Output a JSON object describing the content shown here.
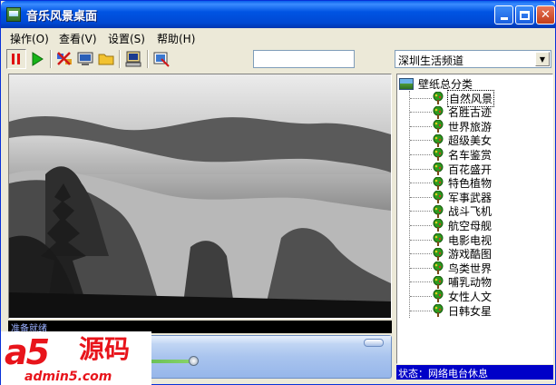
{
  "window": {
    "title": "音乐风景桌面"
  },
  "menu": {
    "items": [
      {
        "label": "操作(O)"
      },
      {
        "label": "查看(V)"
      },
      {
        "label": "设置(S)"
      },
      {
        "label": "帮助(H)"
      }
    ]
  },
  "toolbar": {
    "search_value": "",
    "channel_selected": "深圳生活频道",
    "icons": [
      "pause-icon",
      "play-icon",
      "shuffle-icon",
      "monitor-icon",
      "folder-icon",
      "desktop-icon",
      "wallpaper-icon"
    ]
  },
  "viewer": {
    "status_message": "准备就绪"
  },
  "player": {
    "volume_level_percent": 95
  },
  "tree": {
    "root_label": "壁纸总分类",
    "selected_index": 0,
    "items": [
      {
        "label": "自然风景"
      },
      {
        "label": "名胜古迹"
      },
      {
        "label": "世界旅游"
      },
      {
        "label": "超级美女"
      },
      {
        "label": "名车鉴赏"
      },
      {
        "label": "百花盛开"
      },
      {
        "label": "特色植物"
      },
      {
        "label": "军事武器"
      },
      {
        "label": "战斗飞机"
      },
      {
        "label": "航空母舰"
      },
      {
        "label": "电影电视"
      },
      {
        "label": "游戏酷图"
      },
      {
        "label": "鸟类世界"
      },
      {
        "label": "哺乳动物"
      },
      {
        "label": "女性人文"
      },
      {
        "label": "日韩女星"
      }
    ]
  },
  "statusbar": {
    "text": "状态：网络电台休息"
  },
  "watermark": {
    "brand": "a5",
    "brand_cn": "源码",
    "url": "admin5.com"
  },
  "colors": {
    "titlebar": "#0054e3",
    "status_bg": "#0000c8",
    "watermark": "#e8141b"
  }
}
